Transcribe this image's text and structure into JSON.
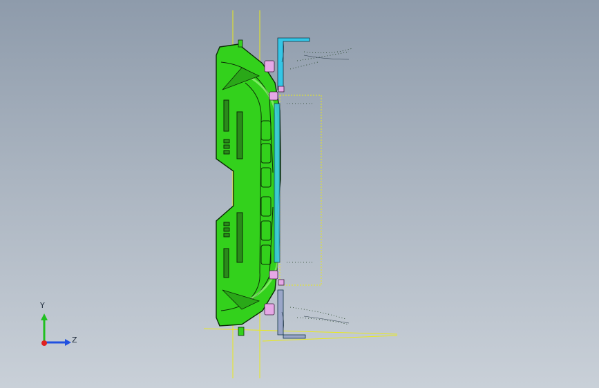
{
  "viewport": {
    "background_top": "#8e9bab",
    "background_bottom": "#c9d0d8"
  },
  "model": {
    "part_color": "#33d11c",
    "part_edge_color": "#0b2a06",
    "clip_color": "#e6a8e6",
    "rail_color": "#35c6e6",
    "reference_plane_color": "#f0f020"
  },
  "triad": {
    "x_color": "#e02020",
    "y_color": "#20c020",
    "z_color": "#2050e0",
    "y_label": "Y",
    "z_label": "Z"
  }
}
